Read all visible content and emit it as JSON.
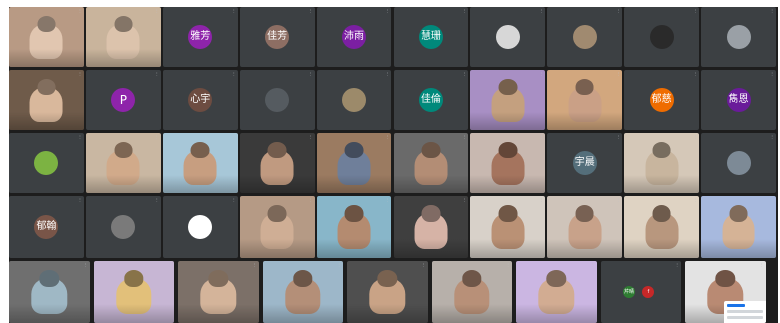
{
  "meeting": {
    "participants": [
      {
        "id": "p1",
        "type": "camera",
        "bg": "#b89a84",
        "person": "#e1c6b0"
      },
      {
        "id": "p2",
        "type": "camera",
        "bg": "#c9b49c",
        "person": "#dcc3ac"
      },
      {
        "id": "p3",
        "type": "avatar",
        "avatar_text": "雅芳",
        "avatar_color": "#8e24aa"
      },
      {
        "id": "p4",
        "type": "avatar",
        "avatar_text": "佳芳",
        "avatar_color": "#8d6e63"
      },
      {
        "id": "p5",
        "type": "avatar",
        "avatar_text": "沛雨",
        "avatar_color": "#7b1fa2"
      },
      {
        "id": "p6",
        "type": "avatar",
        "avatar_text": "慧珊",
        "avatar_color": "#00897b"
      },
      {
        "id": "p7",
        "type": "avatar_pic",
        "avatar_color": "#d7d7d7"
      },
      {
        "id": "p8",
        "type": "avatar_pic",
        "avatar_color": "#a08a70"
      },
      {
        "id": "p9",
        "type": "avatar_pic",
        "avatar_color": "#2a2a2a"
      },
      {
        "id": "p10",
        "type": "avatar_pic",
        "avatar_color": "#9aa0a6"
      },
      {
        "id": "p11",
        "type": "camera",
        "bg": "#6f5b4a",
        "person": "#d9b89c"
      },
      {
        "id": "p12",
        "type": "avatar",
        "avatar_text": "P",
        "avatar_color": "#8e24aa",
        "letter": true
      },
      {
        "id": "p13",
        "type": "avatar",
        "avatar_text": "心宇",
        "avatar_color": "#6d4c41"
      },
      {
        "id": "p14",
        "type": "avatar_pic",
        "avatar_color": "#555b60"
      },
      {
        "id": "p15",
        "type": "avatar_pic",
        "avatar_color": "#9c8a6a"
      },
      {
        "id": "p16",
        "type": "avatar",
        "avatar_text": "佳倫",
        "avatar_color": "#00897b"
      },
      {
        "id": "p17",
        "type": "camera",
        "bg": "#a88fc4",
        "person": "#c4a07f"
      },
      {
        "id": "p18",
        "type": "camera",
        "bg": "#d2a77e",
        "person": "#caa086"
      },
      {
        "id": "p19",
        "type": "avatar",
        "avatar_text": "郁慈",
        "avatar_color": "#ef6c00"
      },
      {
        "id": "p20",
        "type": "avatar",
        "avatar_text": "雋恩",
        "avatar_color": "#6a1b9a"
      },
      {
        "id": "p21",
        "type": "avatar_pic",
        "avatar_color": "#7cb342"
      },
      {
        "id": "p22",
        "type": "camera",
        "bg": "#c9b7a2",
        "person": "#d1aa8a"
      },
      {
        "id": "p23",
        "type": "camera",
        "bg": "#a7c7d8",
        "person": "#c79e80"
      },
      {
        "id": "p24",
        "type": "camera",
        "bg": "#3a3a3a",
        "person": "#c09a80"
      },
      {
        "id": "p25",
        "type": "camera",
        "bg": "#9b7b61",
        "person": "#6f7f9a"
      },
      {
        "id": "p26",
        "type": "camera",
        "bg": "#6a6a6a",
        "person": "#b38d75"
      },
      {
        "id": "p27",
        "type": "camera",
        "bg": "#c8b8b0",
        "person": "#a5745e"
      },
      {
        "id": "p28",
        "type": "avatar",
        "avatar_text": "宇晨",
        "avatar_color": "#546e7a"
      },
      {
        "id": "p29",
        "type": "camera",
        "bg": "#d5c8b8",
        "person": "#c8b59e"
      },
      {
        "id": "p30",
        "type": "avatar_pic",
        "avatar_color": "#7d8a96"
      },
      {
        "id": "p31",
        "type": "avatar",
        "avatar_text": "郁翰",
        "avatar_color": "#795548"
      },
      {
        "id": "p32",
        "type": "avatar_pic",
        "avatar_color": "#7a7a7a"
      },
      {
        "id": "p33",
        "type": "avatar_pic",
        "avatar_color": "#ffffff"
      },
      {
        "id": "p34",
        "type": "camera",
        "bg": "#b59a85",
        "person": "#cfae95"
      },
      {
        "id": "p35",
        "type": "camera",
        "bg": "#88b6c9",
        "person": "#b48b70"
      },
      {
        "id": "p36",
        "type": "camera",
        "bg": "#3f3f3f",
        "person": "#d6b3a6"
      },
      {
        "id": "p37",
        "type": "camera",
        "bg": "#d8d1c9",
        "person": "#ba9175"
      },
      {
        "id": "p38",
        "type": "camera",
        "bg": "#cfc4ba",
        "person": "#c8a28a"
      },
      {
        "id": "p39",
        "type": "camera",
        "bg": "#dfd3c3",
        "person": "#b8977e"
      },
      {
        "id": "p40",
        "type": "camera",
        "bg": "#a7b9de",
        "person": "#d5b396"
      },
      {
        "id": "p41",
        "type": "camera",
        "bg": "#6f6f6f",
        "person": "#9fb8c5"
      },
      {
        "id": "p42",
        "type": "camera",
        "bg": "#c7b6d4",
        "person": "#e2c07a"
      },
      {
        "id": "p43",
        "type": "camera",
        "bg": "#7c7068",
        "person": "#d4b49a"
      },
      {
        "id": "p44",
        "type": "camera",
        "bg": "#9db7c9",
        "person": "#b48f78"
      },
      {
        "id": "p45",
        "type": "camera",
        "bg": "#4f4f4f",
        "person": "#c9a386"
      },
      {
        "id": "p46",
        "type": "camera",
        "bg": "#b7b0aa",
        "person": "#b89078"
      },
      {
        "id": "p47",
        "type": "camera",
        "bg": "#cbb6e2",
        "person": "#d2ac92"
      },
      {
        "id": "p48",
        "type": "avatar_pair",
        "avatar_text": "芹晴",
        "avatar_text2": "f",
        "avatar_color": "#2e7d32",
        "avatar_color2": "#c62828"
      },
      {
        "id": "p49",
        "type": "camera",
        "bg": "#e3e3e3",
        "person": "#b98a73",
        "chat": true
      }
    ]
  }
}
